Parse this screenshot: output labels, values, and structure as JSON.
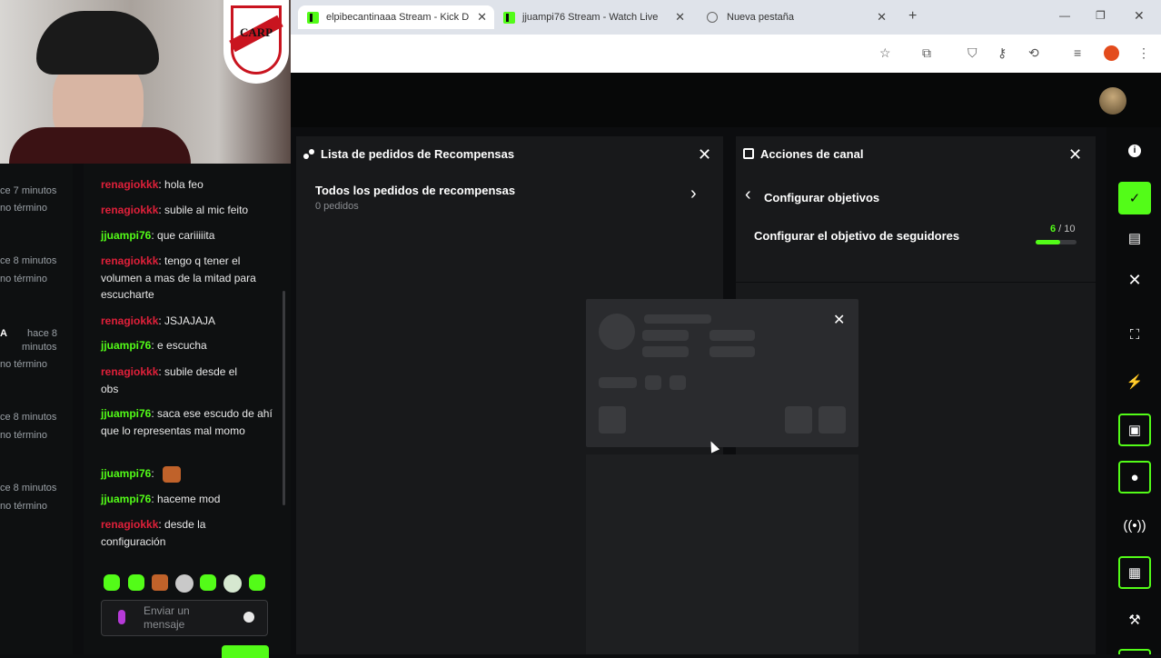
{
  "browser": {
    "tabs": [
      {
        "title": "elpibecantinaaa Stream - Kick D",
        "close": "✕"
      },
      {
        "title": "jjuampi76 Stream - Watch Live",
        "close": "✕"
      },
      {
        "title": "Nueva pestaña",
        "close": "✕"
      }
    ],
    "new_tab": "+",
    "window_controls": [
      "—",
      "❐",
      "✕"
    ]
  },
  "webcam": {
    "badge_text": "CARP"
  },
  "events": [
    {
      "line1": "ce 7 minutos",
      "line2": "no término"
    },
    {
      "line1": "ce 8 minutos",
      "line2": "no término"
    },
    {
      "line0": "A",
      "line1": "hace 8",
      "line1b": "minutos",
      "line2": "no término"
    },
    {
      "line1": "ce 8 minutos",
      "line2": "no término"
    },
    {
      "line1": "ce 8 minutos",
      "line2": "no término"
    }
  ],
  "chat": {
    "messages": [
      {
        "user": "renagiokkk",
        "text": ": hola feo",
        "color": "#e0203a"
      },
      {
        "user": "renagiokkk",
        "text": ": subile al mic feito",
        "color": "#e0203a"
      },
      {
        "user": "jjuampi76",
        "text": ": que cariiiiita",
        "color": "#53fc18"
      },
      {
        "user": "renagiokkk",
        "text": ": tengo q tener el volumen a mas de la mitad para escucharte",
        "color": "#e0203a"
      },
      {
        "user": "renagiokkk",
        "text": ": JSJAJAJA",
        "color": "#e0203a"
      },
      {
        "user": "jjuampi76",
        "text": ": e escucha",
        "color": "#53fc18"
      },
      {
        "user": "renagiokkk",
        "text": ": subile desde el obs",
        "color": "#e0203a"
      },
      {
        "user": "jjuampi76",
        "text": ": saca ese escudo de ahí que lo representas mal momo",
        "color": "#53fc18"
      },
      {
        "user": "jjuampi76",
        "text": ":",
        "color": "#53fc18"
      },
      {
        "user": "jjuampi76",
        "text": ": haceme mod",
        "color": "#53fc18"
      },
      {
        "user": "renagiokkk",
        "text": ": desde la configuración",
        "color": "#e0203a"
      }
    ],
    "input_placeholder": "Enviar un mensaje"
  },
  "rewards_panel": {
    "title": "Lista de pedidos de Recompensas",
    "item_title": "Todos los pedidos de recompensas",
    "item_sub": "0 pedidos"
  },
  "channel_panel": {
    "title": "Acciones de canal",
    "back_label": "Configurar objetivos",
    "goal_label": "Configurar el objetivo de seguidores",
    "goal_current": "6",
    "goal_total": " / 10",
    "goal_progress": 0.6
  },
  "colors": {
    "accent": "#53fc18",
    "bg": "#0c0d0f",
    "panel": "#18191b",
    "mod_red": "#e0203a"
  }
}
